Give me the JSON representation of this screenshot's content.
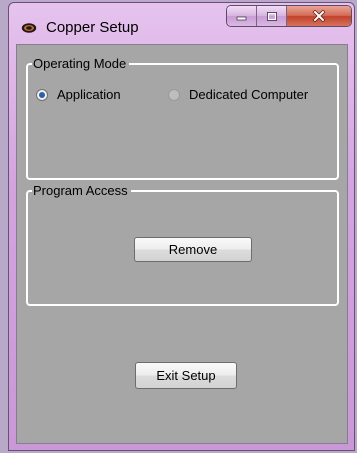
{
  "window": {
    "title": "Copper Setup",
    "icon": "copper-eye-icon"
  },
  "operating_mode": {
    "label": "Operating Mode",
    "options": [
      {
        "label": "Application",
        "selected": true
      },
      {
        "label": "Dedicated Computer",
        "selected": false
      }
    ]
  },
  "program_access": {
    "label": "Program Access",
    "remove_label": "Remove"
  },
  "footer": {
    "exit_label": "Exit Setup"
  },
  "colors": {
    "titlebar": "#d3a5df",
    "client_bg": "#a6a6a6",
    "close_button": "#c0412a",
    "radio_selected": "#2e5fa8"
  }
}
